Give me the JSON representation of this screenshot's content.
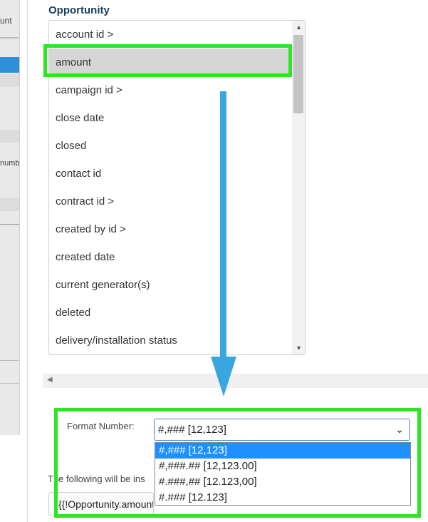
{
  "left_pane": {
    "partial_label_top": "unt",
    "partial_label_mid": "numb"
  },
  "section_title": "Opportunity",
  "fields": [
    "account id >",
    "amount",
    "campaign id >",
    "close date",
    "closed",
    "contact id",
    "contract id >",
    "created by id >",
    "created date",
    "current generator(s)",
    "deleted",
    "delivery/installation status"
  ],
  "selected_field": "amount",
  "format": {
    "label": "Format Number:",
    "selected_value": "#,### [12,123]",
    "options": [
      "#,### [12,123]",
      "#,###.## [12,123.00]",
      "#.###,## [12.123,00]",
      "#.### [12.123]"
    ]
  },
  "following_text": "The following will be ins",
  "merge_field_value": "{{!Opportunity.amount #,###}}",
  "colors": {
    "highlight": "#2ee523",
    "arrow": "#3aa6e0",
    "active_option": "#1e90ff"
  }
}
